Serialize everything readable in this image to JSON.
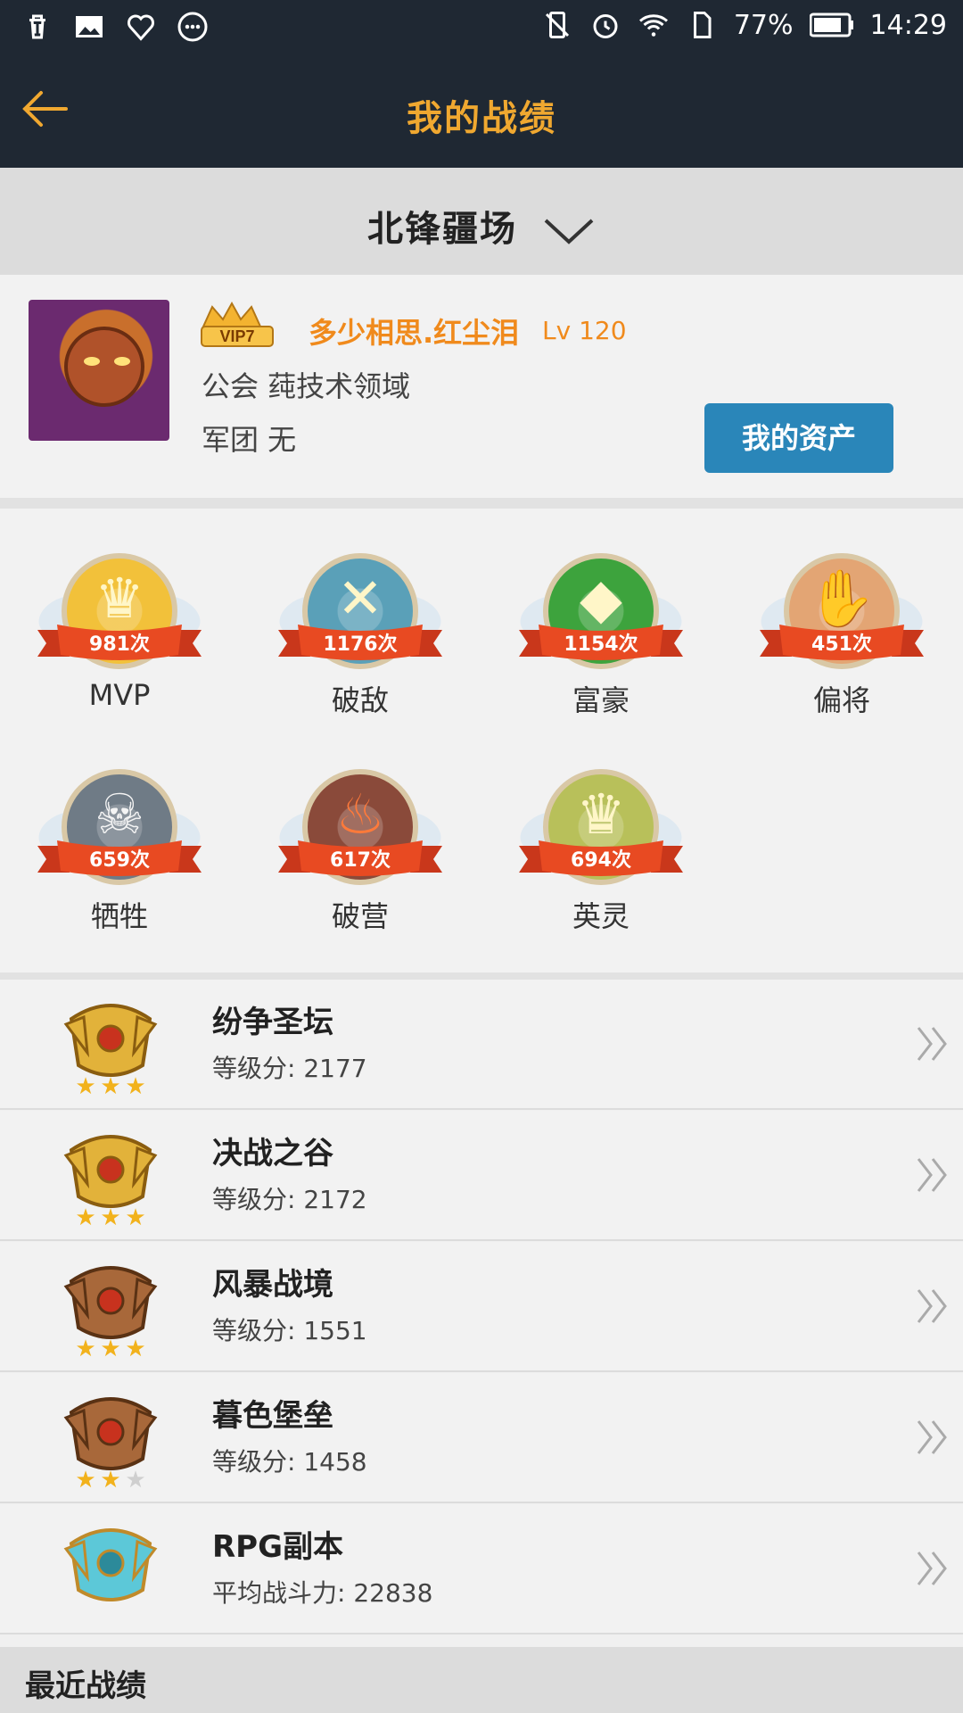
{
  "status_bar": {
    "battery_percent": "77%",
    "time": "14:29",
    "left_icons": [
      "trash-icon",
      "image-icon",
      "heart-shield-icon",
      "more-dots-icon"
    ],
    "right_icons": [
      "vibrate-off-icon",
      "alarm-icon",
      "wifi-icon",
      "sim-icon",
      "battery-icon"
    ]
  },
  "header": {
    "title": "我的战绩"
  },
  "server": {
    "name": "北锋疆场"
  },
  "profile": {
    "vip": "VIP7",
    "username": "多少相思.红尘泪",
    "level": "Lv 120",
    "guild": "公会 莼技术领域",
    "legion": "军团 无",
    "asset_button": "我的资产"
  },
  "badges": [
    {
      "label": "MVP",
      "count": "981次",
      "icon": "crown-icon",
      "color": "#f2c13a"
    },
    {
      "label": "破敌",
      "count": "1176次",
      "icon": "crossed-blades-icon",
      "color": "#5aa0b8"
    },
    {
      "label": "富豪",
      "count": "1154次",
      "icon": "diamond-icon",
      "color": "#3da33d"
    },
    {
      "label": "偏将",
      "count": "451次",
      "icon": "handshake-icon",
      "color": "#e3a574"
    },
    {
      "label": "牺牲",
      "count": "659次",
      "icon": "skull-icon",
      "color": "#6f7b86"
    },
    {
      "label": "破营",
      "count": "617次",
      "icon": "flame-icon",
      "color": "#8a4a3a"
    },
    {
      "label": "英灵",
      "count": "694次",
      "icon": "crown-icon",
      "color": "#b8c05a"
    }
  ],
  "modes": [
    {
      "name": "纷争圣坛",
      "score_label": "等级分: 2177",
      "medal": "gold-medal-icon",
      "stars": 3
    },
    {
      "name": "决战之谷",
      "score_label": "等级分: 2172",
      "medal": "gold-medal-icon",
      "stars": 3
    },
    {
      "name": "风暴战境",
      "score_label": "等级分: 1551",
      "medal": "bronze-medal-icon",
      "stars": 3
    },
    {
      "name": "暮色堡垒",
      "score_label": "等级分: 1458",
      "medal": "bronze-medal-icon",
      "stars": 2
    },
    {
      "name": "RPG副本",
      "score_label": "平均战斗力: 22838",
      "medal": "rpg-medal-icon",
      "stars": 0
    }
  ],
  "recent": {
    "title": "最近战绩"
  },
  "colors": {
    "header_bg": "#1f2833",
    "title": "#f0a830",
    "accent_button": "#2a86b9",
    "username": "#f08a1c"
  }
}
